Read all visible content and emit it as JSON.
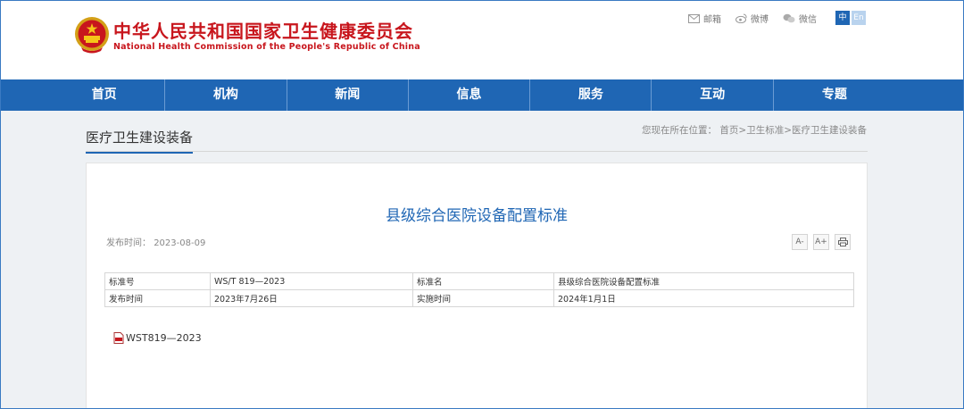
{
  "header": {
    "title_cn": "中华人民共和国国家卫生健康委员会",
    "title_en": "National Health Commission of the People's Republic of China",
    "links": [
      {
        "label": "邮箱",
        "icon": "mail-icon"
      },
      {
        "label": "微博",
        "icon": "weibo-icon"
      },
      {
        "label": "微信",
        "icon": "wechat-icon"
      }
    ],
    "lang_zh": "中",
    "lang_en": "En"
  },
  "nav": [
    "首页",
    "机构",
    "新闻",
    "信息",
    "服务",
    "互动",
    "专题"
  ],
  "section": {
    "title": "医疗卫生建设装备",
    "crumb_prefix": "您现在所在位置：",
    "crumb_path": "首页>卫生标准>医疗卫生建设装备"
  },
  "article": {
    "title": "县级综合医院设备配置标准",
    "pub_label": "发布时间：",
    "pub_date": "2023-08-09",
    "tools": [
      "A-",
      "A+",
      "print"
    ],
    "table": [
      [
        "标准号",
        "WS/T 819—2023",
        "标准名",
        "县级综合医院设备配置标准"
      ],
      [
        "发布时间",
        "2023年7月26日",
        "实施时间",
        "2024年1月1日"
      ]
    ],
    "attachment": "WST819—2023"
  },
  "colors": {
    "brand_red": "#c8161d",
    "nav_blue": "#1f66b4"
  }
}
